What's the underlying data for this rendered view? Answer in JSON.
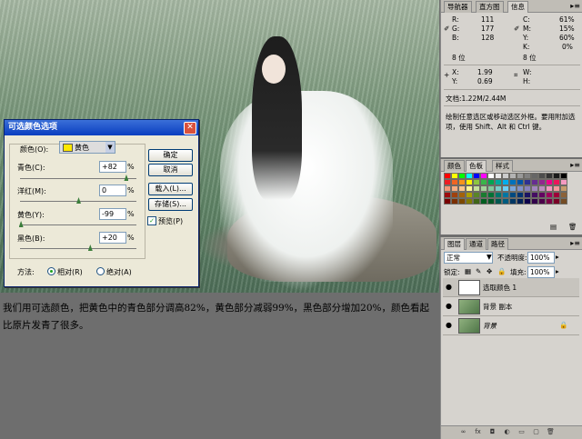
{
  "dialog": {
    "title": "可选颜色选项",
    "color_label": "颜色(O):",
    "color_value": "黄色",
    "sliders": [
      {
        "label": "青色(C):",
        "value": "+82",
        "unit": "%",
        "level": 0.91
      },
      {
        "label": "洋红(M):",
        "value": "0",
        "unit": "%",
        "level": 0.5
      },
      {
        "label": "黄色(Y):",
        "value": "-99",
        "unit": "%",
        "level": 0.005
      },
      {
        "label": "黑色(B):",
        "value": "+20",
        "unit": "%",
        "level": 0.6
      }
    ],
    "buttons": {
      "ok": "确定",
      "cancel": "取消",
      "load": "载入(L)...",
      "save": "存储(S)..."
    },
    "preview_label": "预览(P)",
    "preview_checked": true,
    "method_label": "方法:",
    "method_relative": "相对(R)",
    "method_absolute": "绝对(A)",
    "method_selected": "relative"
  },
  "caption": "我们用可选颜色，把黄色中的青色部分调高82%，黄色部分减弱99%，黑色部分增加20%，颜色看起比原片发青了很多。",
  "info_panel": {
    "tabs": [
      "导航器",
      "直方图",
      "信息"
    ],
    "active_tab": "信息",
    "rgb": {
      "r_label": "R:",
      "r": "111",
      "g_label": "G:",
      "g": "177",
      "b_label": "B:",
      "b": "128"
    },
    "cmyk": {
      "c_label": "C:",
      "c": "61%",
      "m_label": "M:",
      "m": "15%",
      "y_label": "Y:",
      "y": "60%",
      "k_label": "K:",
      "k": "0%"
    },
    "bits_left": "8 位",
    "bits_right": "8 位",
    "xy": {
      "x_label": "X:",
      "x": "1.99",
      "y_label": "Y:",
      "y": "0.69"
    },
    "wh": {
      "w_label": "W:",
      "h_label": "H:"
    },
    "doc": "文档:1.22M/2.44M",
    "hint": "绘制任意选区或移动选区外框。要用附加选项，使用 Shift、Alt 和 Ctrl 键。"
  },
  "swatch_panel": {
    "tabs": [
      "颜色",
      "色板",
      "样式"
    ],
    "active_tab": "色板",
    "colors": [
      "#ff0000",
      "#ffff00",
      "#00ff00",
      "#00ffff",
      "#0000ff",
      "#ff00ff",
      "#ffffff",
      "#e6e6e6",
      "#cccccc",
      "#b3b3b3",
      "#999999",
      "#808080",
      "#666666",
      "#4d4d4d",
      "#333333",
      "#1a1a1a",
      "#000000",
      "#ed1c24",
      "#f26522",
      "#f7941d",
      "#fff200",
      "#8dc63f",
      "#39b54a",
      "#00a651",
      "#00a99d",
      "#00aeef",
      "#0072bc",
      "#0054a6",
      "#2e3192",
      "#662d91",
      "#92278f",
      "#ec008c",
      "#ed145b",
      "#f49ac1",
      "#f69679",
      "#f9ad81",
      "#fdc68a",
      "#fff79a",
      "#c4df9b",
      "#a3d39c",
      "#82ca9c",
      "#7accc8",
      "#6dcff6",
      "#7da7d9",
      "#8393ca",
      "#8781bd",
      "#a186be",
      "#bd8cbf",
      "#f49ac2",
      "#f6989d",
      "#c69c6d",
      "#9e0b0f",
      "#a0410d",
      "#a36209",
      "#aba000",
      "#598527",
      "#1a7b30",
      "#007236",
      "#00746b",
      "#0076a3",
      "#004a80",
      "#003471",
      "#1b1464",
      "#440e62",
      "#630460",
      "#9e005d",
      "#9e0039",
      "#8c6239",
      "#790000",
      "#7b2e00",
      "#7d4900",
      "#827b00",
      "#406618",
      "#005e20",
      "#005826",
      "#005952",
      "#005b7f",
      "#003663",
      "#002157",
      "#0d004c",
      "#32004b",
      "#4b0049",
      "#7b0046",
      "#7a0026",
      "#754c24"
    ],
    "icons": [
      "folder-icon",
      "trash-icon"
    ]
  },
  "layers_panel": {
    "tabs": [
      "图层",
      "通道",
      "路径"
    ],
    "active_tab": "图层",
    "blend_mode": "正常",
    "opacity_label": "不透明度:",
    "opacity": "100%",
    "lock_label": "锁定:",
    "fill_label": "填充:",
    "fill": "100%",
    "layers": [
      {
        "name": "选取颜色 1",
        "visible": true,
        "selected": true,
        "kind": "adjustment"
      },
      {
        "name": "背景 副本",
        "visible": true,
        "selected": false,
        "kind": "image"
      },
      {
        "name": "背景",
        "visible": true,
        "selected": false,
        "kind": "image",
        "locked": true
      }
    ]
  }
}
